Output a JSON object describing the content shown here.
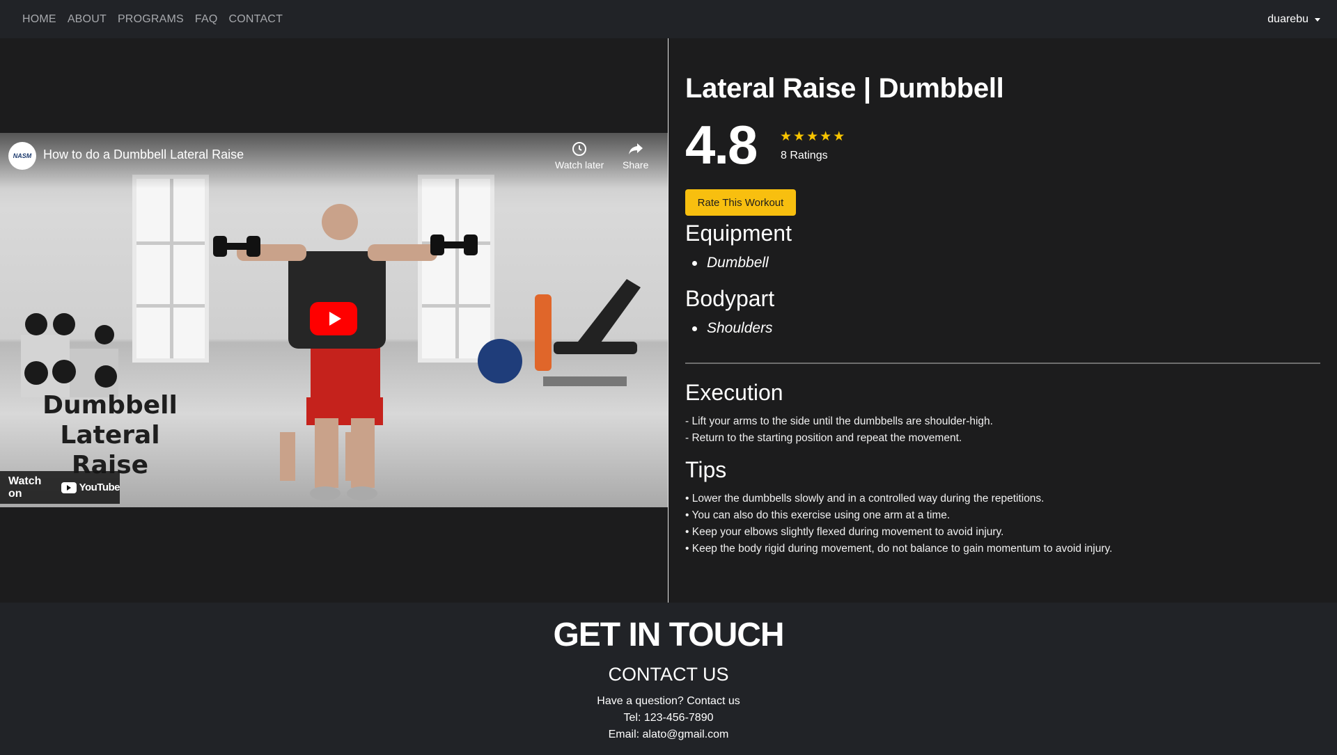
{
  "navbar": {
    "links": [
      "HOME",
      "ABOUT",
      "PROGRAMS",
      "FAQ",
      "CONTACT"
    ],
    "user": "duarebu"
  },
  "video": {
    "channel_logo_text": "NASM",
    "title": "How to do a Dumbbell Lateral Raise",
    "watch_later": "Watch later",
    "share": "Share",
    "caption_line1": "Dumbbell",
    "caption_line2": "Lateral Raise",
    "watch_on": "Watch on",
    "youtube": "YouTube"
  },
  "workout": {
    "title": "Lateral Raise | Dumbbell",
    "rating": "4.8",
    "stars": 5,
    "ratings_count": "8 Ratings",
    "rate_button": "Rate This Workout",
    "equipment_heading": "Equipment",
    "equipment": [
      "Dumbbell"
    ],
    "bodypart_heading": "Bodypart",
    "bodyparts": [
      "Shoulders"
    ],
    "execution_heading": "Execution",
    "execution": [
      "- Lift your arms to the side until the dumbbells are shoulder-high.",
      "- Return to the starting position and repeat the movement."
    ],
    "tips_heading": "Tips",
    "tips": [
      "• Lower the dumbbells slowly and in a controlled way during the repetitions.",
      "• You can also do this exercise using one arm at a time.",
      "• Keep your elbows slightly flexed during movement to avoid injury.",
      "• Keep the body rigid during movement, do not balance to gain momentum to avoid injury."
    ]
  },
  "footer": {
    "title": "GET IN TOUCH",
    "subtitle": "CONTACT US",
    "question": "Have a question? Contact us",
    "tel": "Tel: 123-456-7890",
    "email": "Email: alato@gmail.com"
  },
  "colors": {
    "accent": "#f8bf0f",
    "star": "#f7c400",
    "youtube_red": "#ff0000"
  }
}
